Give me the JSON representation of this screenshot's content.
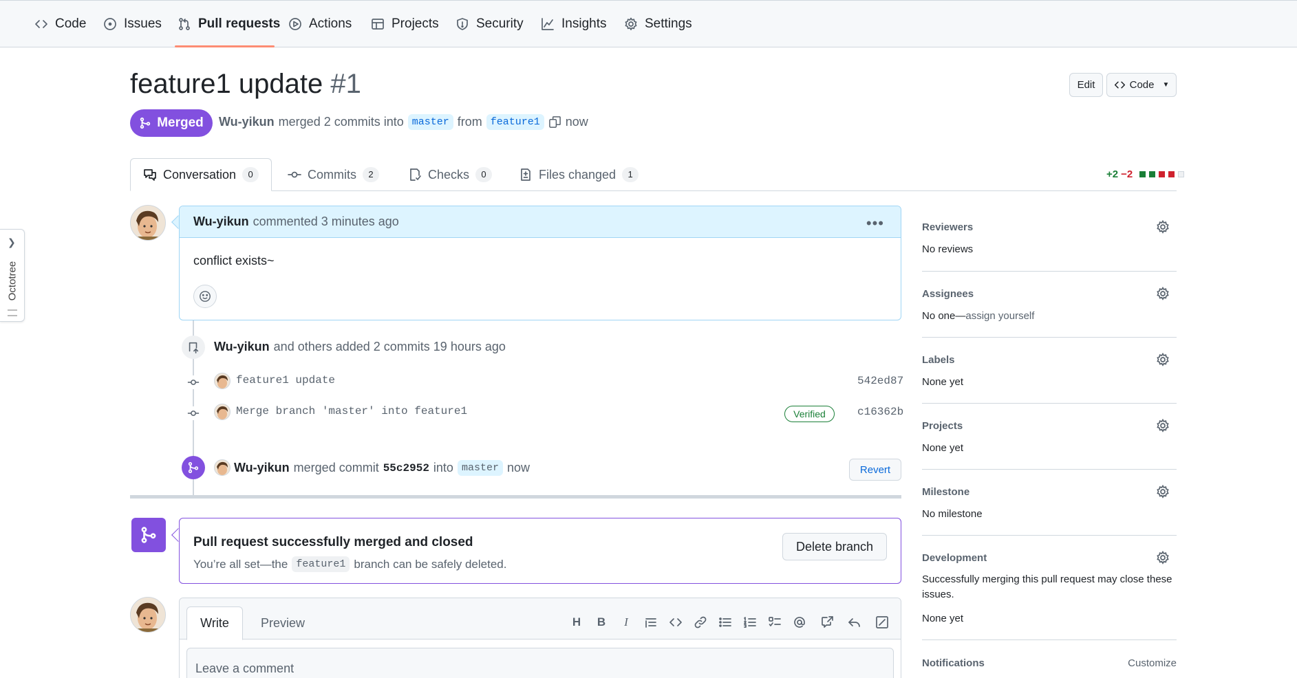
{
  "nav": {
    "items": [
      {
        "label": "Code",
        "icon": "code-icon"
      },
      {
        "label": "Issues",
        "icon": "issue-icon"
      },
      {
        "label": "Pull requests",
        "icon": "pull-request-icon"
      },
      {
        "label": "Actions",
        "icon": "play-icon"
      },
      {
        "label": "Projects",
        "icon": "table-icon"
      },
      {
        "label": "Security",
        "icon": "shield-icon"
      },
      {
        "label": "Insights",
        "icon": "graph-icon"
      },
      {
        "label": "Settings",
        "icon": "gear-icon"
      }
    ],
    "active": "Pull requests"
  },
  "octotree": {
    "label": "Octotree"
  },
  "header": {
    "title": "feature1 update",
    "number": "#1",
    "edit_label": "Edit",
    "code_label": "Code",
    "status": "Merged",
    "author": "Wu-yikun",
    "merged_text": "merged 2 commits into",
    "base_branch": "master",
    "from_text": "from",
    "head_branch": "feature1",
    "time": "now"
  },
  "tabs": [
    {
      "label": "Conversation",
      "count": "0"
    },
    {
      "label": "Commits",
      "count": "2"
    },
    {
      "label": "Checks",
      "count": "0"
    },
    {
      "label": "Files changed",
      "count": "1"
    }
  ],
  "diffstat": {
    "additions": "+2",
    "deletions": "−2"
  },
  "comment": {
    "author": "Wu-yikun",
    "action": "commented 3 minutes ago",
    "body": "conflict exists~"
  },
  "timeline": {
    "commits_event": {
      "author": "Wu-yikun",
      "text": "and others added 2 commits 19 hours ago"
    },
    "commits": [
      {
        "message": "feature1 update",
        "sha": "542ed87",
        "verified": ""
      },
      {
        "message": "Merge branch 'master' into feature1",
        "sha": "c16362b",
        "verified": "Verified"
      }
    ],
    "merge_event": {
      "author": "Wu-yikun",
      "text": "merged commit",
      "commit": "55c2952",
      "into": "into",
      "branch": "master",
      "time": "now",
      "revert_label": "Revert"
    }
  },
  "merged_box": {
    "title": "Pull request successfully merged and closed",
    "sub_before": "You’re all set—the",
    "branch": "feature1",
    "sub_after": "branch can be safely deleted.",
    "delete_label": "Delete branch"
  },
  "editor": {
    "write_label": "Write",
    "preview_label": "Preview",
    "placeholder": "Leave a comment",
    "heading_tool": "H",
    "bold_tool": "B",
    "italic_tool": "I"
  },
  "sidebar": {
    "reviewers": {
      "title": "Reviewers",
      "value": "No reviews"
    },
    "assignees": {
      "title": "Assignees",
      "value_prefix": "No one—",
      "value_link": "assign yourself"
    },
    "labels": {
      "title": "Labels",
      "value": "None yet"
    },
    "projects": {
      "title": "Projects",
      "value": "None yet"
    },
    "milestone": {
      "title": "Milestone",
      "value": "No milestone"
    },
    "development": {
      "title": "Development",
      "desc_line1": "Successfully merging this pull request may close these",
      "desc_line2": "issues.",
      "value": "None yet"
    },
    "notifications": {
      "title": "Notifications",
      "action": "Customize"
    }
  },
  "colors": {
    "accent": "#8250df",
    "link": "#0969da",
    "success": "#1a7f37",
    "danger": "#cf222e",
    "underline": "#fd8c73"
  }
}
